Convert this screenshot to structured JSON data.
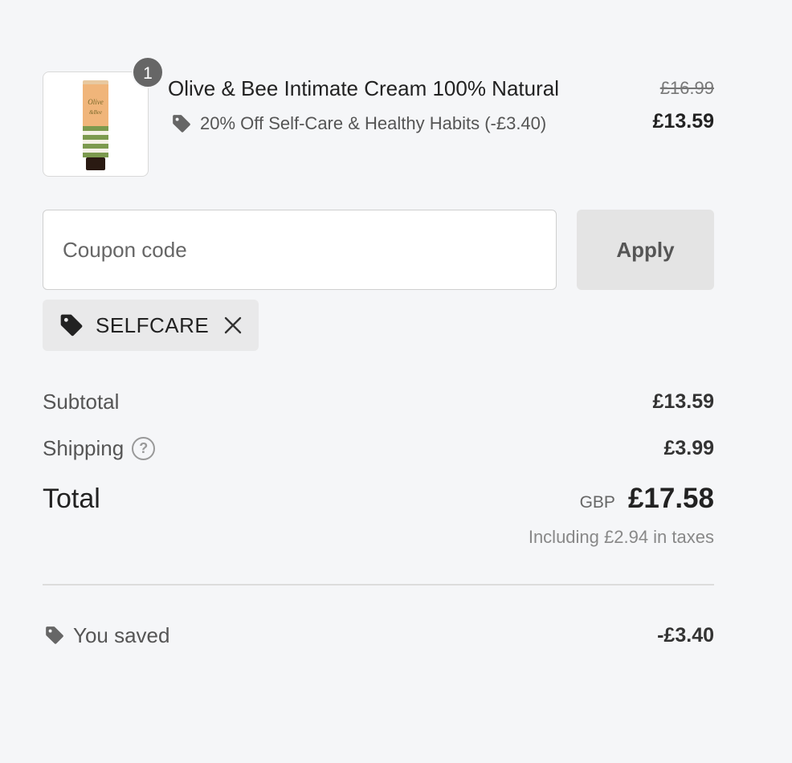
{
  "product": {
    "quantity": "1",
    "name": "Olive & Bee Intimate Cream 100% Natural",
    "discount_label": "20% Off Self-Care & Healthy Habits (-£3.40)",
    "price_original": "£16.99",
    "price_final": "£13.59",
    "image_alt": "Olive & Bee cream tube"
  },
  "coupon": {
    "placeholder": "Coupon code",
    "apply_label": "Apply",
    "applied_code": "SELFCARE"
  },
  "totals": {
    "subtotal_label": "Subtotal",
    "subtotal_value": "£13.59",
    "shipping_label": "Shipping",
    "shipping_help": "?",
    "shipping_value": "£3.99",
    "total_label": "Total",
    "currency": "GBP",
    "total_value": "£17.58",
    "taxes_note": "Including £2.94 in taxes",
    "saved_label": "You saved",
    "saved_value": "-£3.40"
  },
  "icons": {
    "tag": "tag-icon",
    "close": "close-icon",
    "help": "help-circle-icon"
  },
  "colors": {
    "background": "#f5f6f8",
    "badge": "#666666",
    "apply_button": "#e4e4e4",
    "applied_tag": "#e9e9ea"
  }
}
